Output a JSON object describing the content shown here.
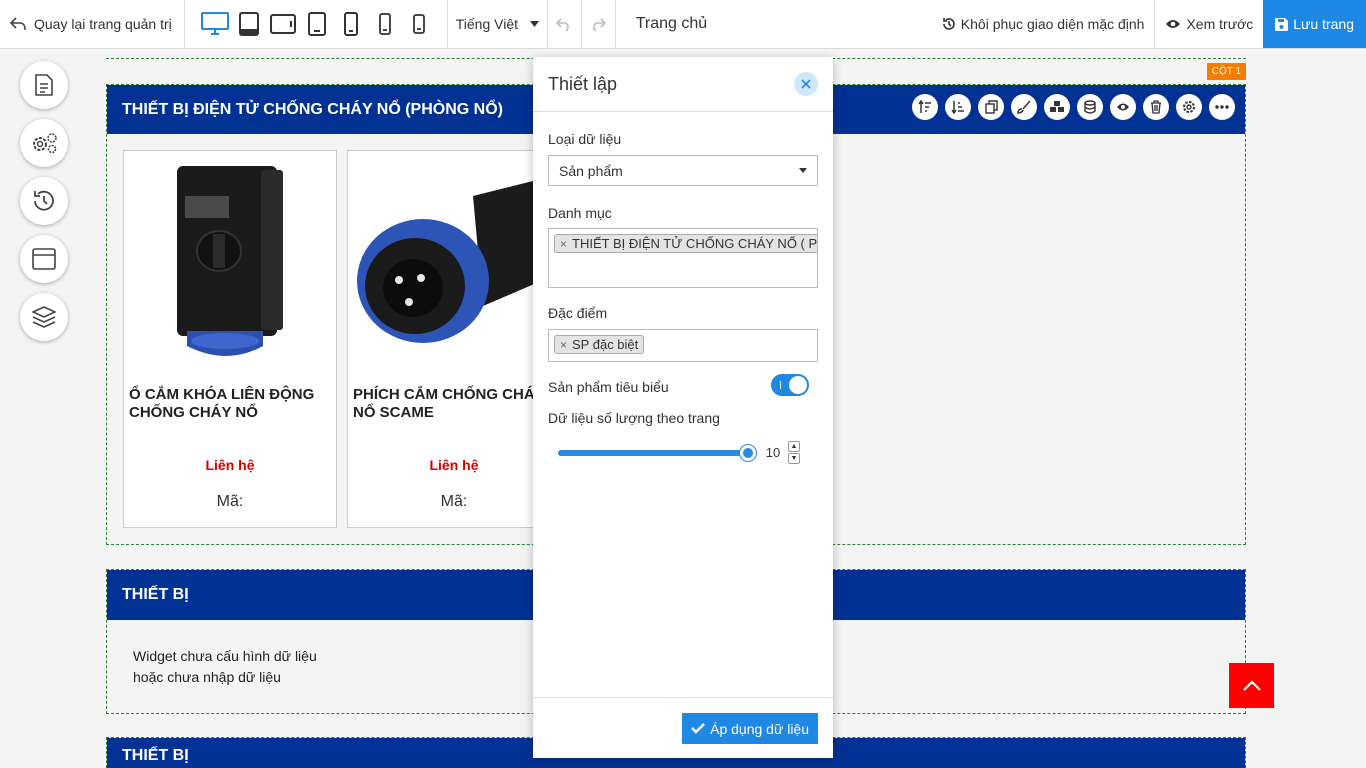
{
  "toolbar": {
    "back_label": "Quay lại trang quản trị",
    "language": "Tiếng Việt",
    "page_name": "Trang chủ",
    "restore_label": "Khôi phục giao diện mặc định",
    "preview_label": "Xem trước",
    "save_label": "Lưu trang",
    "accent_color": "#1e88e5"
  },
  "sections": [
    {
      "title": "THIẾT BỊ ĐIỆN TỬ CHỐNG CHÁY NỔ (PHÒNG NỔ)",
      "column_tag": "CỘT 1",
      "products": [
        {
          "name": "Ổ CẮM KHÓA LIÊN ĐỘNG CHỐNG CHÁY NỔ",
          "price": "Liên hệ",
          "code": "Mã:"
        },
        {
          "name": "PHÍCH CẮM CHỐNG CHÁY NỔ SCAME",
          "price": "Liên hệ",
          "code": "Mã:"
        }
      ]
    },
    {
      "title": "THIẾT BỊ",
      "empty_line1": "Widget chưa cấu hình dữ liệu",
      "empty_line2": "hoặc chưa nhập dữ liệu"
    },
    {
      "title": "THIẾT BỊ"
    }
  ],
  "panel": {
    "title": "Thiết lập",
    "data_type_label": "Loại dữ liệu",
    "data_type_value": "Sản phẩm",
    "category_label": "Danh mục",
    "category_tag": "THIẾT BỊ ĐIỆN TỬ CHỐNG CHÁY NỔ ( PHÒNG NỔ )",
    "feature_label": "Đặc điểm",
    "feature_tag": "SP đặc biệt",
    "featured_label": "Sản phẩm tiêu biểu",
    "featured_on": true,
    "per_page_label": "Dữ liệu số lượng theo trang",
    "per_page_value": "10",
    "per_page_fraction": 1.0,
    "apply_label": "Áp dụng dữ liệu"
  },
  "colors": {
    "section_header": "#023194",
    "price": "#d50000",
    "scroll_top": "#ff0000",
    "column_tag": "#f57c00"
  }
}
